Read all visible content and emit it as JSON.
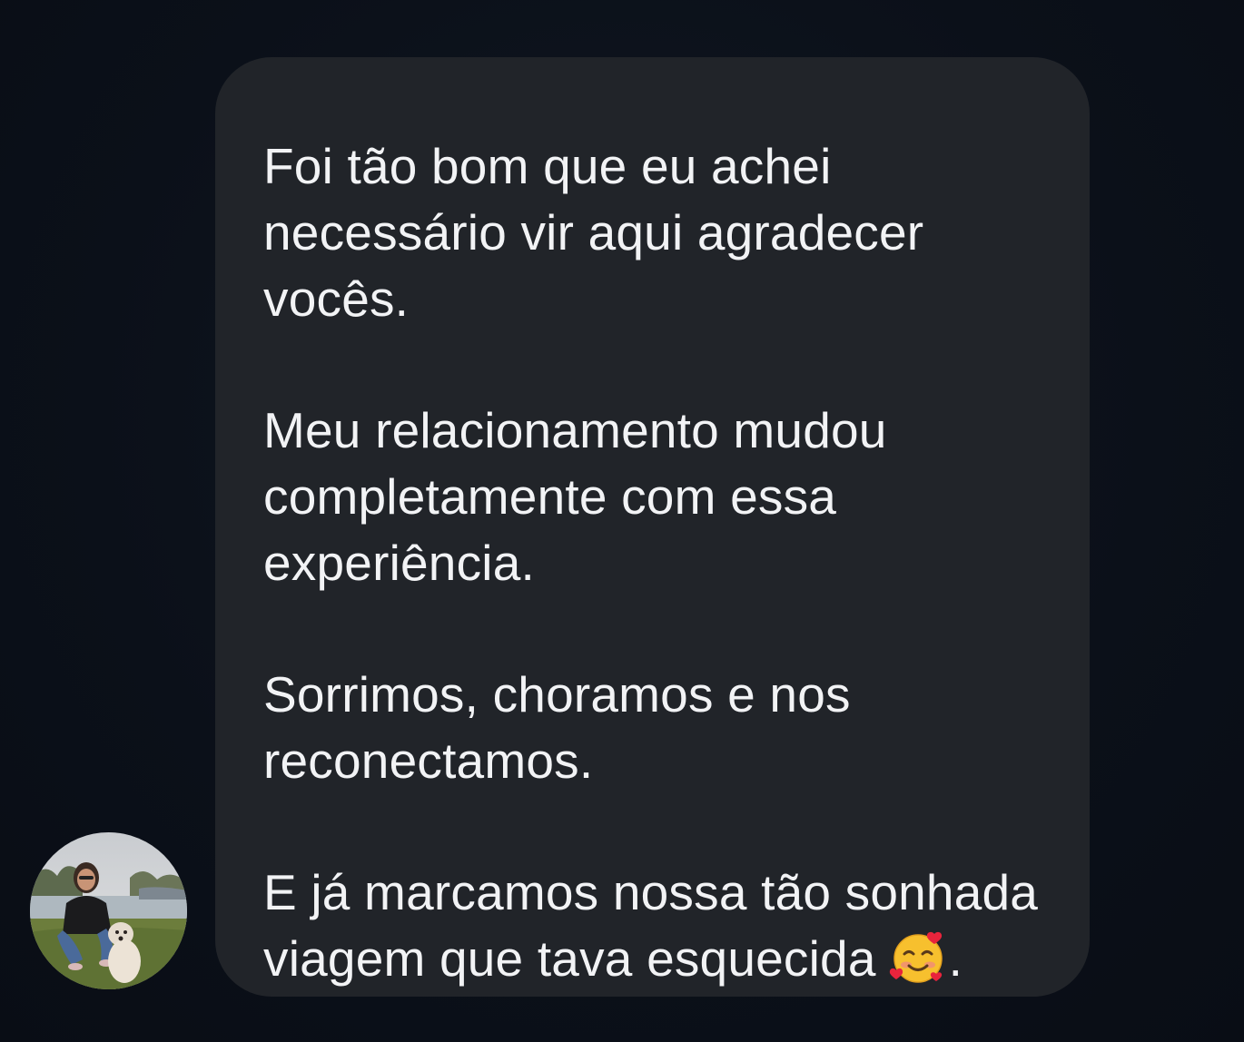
{
  "message": {
    "paragraphs": [
      "Foi tão bom que eu achei\nnecessário vir aqui agradecer\nvocês.",
      "Meu relacionamento mudou\ncompletamente com essa\nexperiência.",
      "Sorrimos, choramos e nos\nreconectamos.",
      "E já marcamos nossa tão sonhada\nviagem que tava esquecida"
    ],
    "trailing_punctuation": ".",
    "emoji": "smiling-face-with-hearts-icon"
  },
  "sender": {
    "avatar": "profile-photo-woman-with-dog"
  },
  "colors": {
    "background": "#0c111a",
    "bubble": "#212429",
    "text": "#f2f3f5"
  }
}
